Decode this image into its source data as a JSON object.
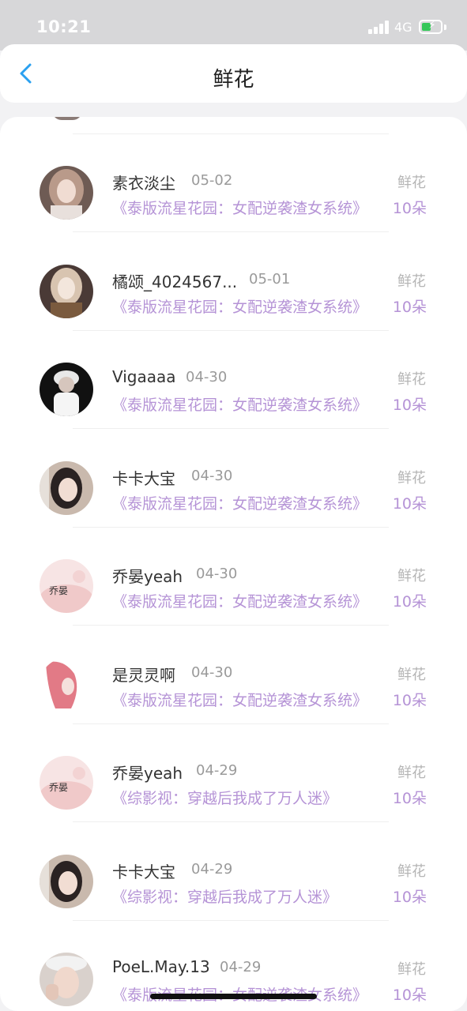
{
  "status_bar": {
    "time": "10:21",
    "network": "4G"
  },
  "header": {
    "title": "鲜花"
  },
  "colors": {
    "accent": "#2aa0f0",
    "book_title": "#b593d6",
    "battery": "#35c759"
  },
  "records": [
    {
      "name": "素衣淡尘",
      "date": "05-02",
      "type": "鲜花",
      "book": "《泰版流星花园：女配逆袭渣女系统》",
      "count": "10朵"
    },
    {
      "name": "橘颂_4024567...",
      "date": "05-01",
      "type": "鲜花",
      "book": "《泰版流星花园：女配逆袭渣女系统》",
      "count": "10朵"
    },
    {
      "name": "Vigaaaa",
      "date": "04-30",
      "type": "鲜花",
      "book": "《泰版流星花园：女配逆袭渣女系统》",
      "count": "10朵"
    },
    {
      "name": "卡卡大宝",
      "date": "04-30",
      "type": "鲜花",
      "book": "《泰版流星花园：女配逆袭渣女系统》",
      "count": "10朵"
    },
    {
      "name": "乔晏yeah",
      "date": "04-30",
      "type": "鲜花",
      "book": "《泰版流星花园：女配逆袭渣女系统》",
      "count": "10朵"
    },
    {
      "name": "是灵灵啊",
      "date": "04-30",
      "type": "鲜花",
      "book": "《泰版流星花园：女配逆袭渣女系统》",
      "count": "10朵"
    },
    {
      "name": "乔晏yeah",
      "date": "04-29",
      "type": "鲜花",
      "book": "《综影视：穿越后我成了万人迷》",
      "count": "10朵"
    },
    {
      "name": "卡卡大宝",
      "date": "04-29",
      "type": "鲜花",
      "book": "《综影视：穿越后我成了万人迷》",
      "count": "10朵"
    },
    {
      "name": "PoeL.May.13",
      "date": "04-29",
      "type": "鲜花",
      "book": "《泰版流星花园：女配逆袭渣女系统》",
      "count": "10朵"
    }
  ]
}
